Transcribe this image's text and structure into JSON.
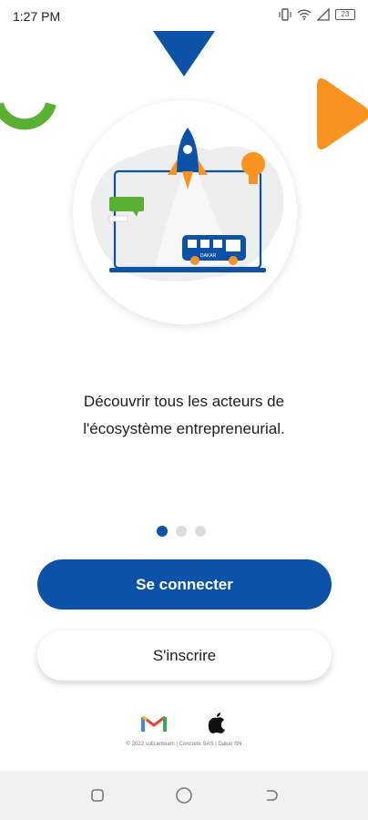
{
  "status_bar": {
    "time": "1:27 PM",
    "battery": "23",
    "icons": [
      "vibrate-icon",
      "wifi-icon",
      "signal-icon",
      "battery-icon"
    ]
  },
  "illustration": {
    "bus_label": "DAKAR",
    "icon": "rocket-laptop-illustration"
  },
  "onboarding": {
    "line1": "Découvrir tous les acteurs de",
    "line2": "l'écosystème entrepreneurial.",
    "page_index": 1,
    "page_count": 3
  },
  "buttons": {
    "login_label": "Se connecter",
    "signup_label": "S'inscrire"
  },
  "social": {
    "google_icon": "gmail-icon",
    "apple_icon": "apple-icon"
  },
  "footer": {
    "text": "© 2022 sollcenteam | Concrete SAS | Dakar SN"
  },
  "colors": {
    "primary": "#0b52a8",
    "accent_orange": "#f7931e",
    "accent_green": "#5ab031"
  }
}
